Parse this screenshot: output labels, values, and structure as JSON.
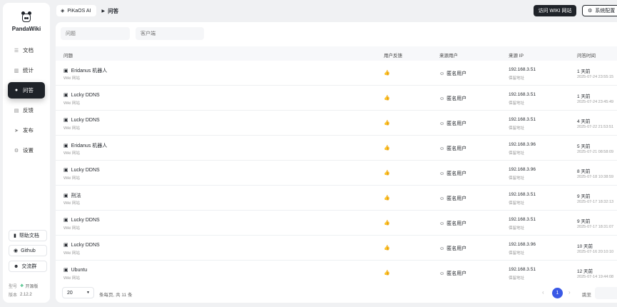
{
  "brand": {
    "name": "PandaWiki"
  },
  "sidebar": {
    "items": [
      {
        "icon": "document-icon",
        "label": "文档"
      },
      {
        "icon": "stats-icon",
        "label": "统计"
      },
      {
        "icon": "qa-icon",
        "label": "问答",
        "active": true
      },
      {
        "icon": "feedback-icon",
        "label": "反馈"
      },
      {
        "icon": "publish-icon",
        "label": "发布"
      },
      {
        "icon": "settings-icon",
        "label": "设置"
      }
    ],
    "footer": {
      "help": "帮助文档",
      "github": "Github",
      "community": "交流群",
      "edition_key": "型号",
      "edition_value": "开源版",
      "version_key": "版本",
      "version_value": "2.12.2"
    }
  },
  "header": {
    "workspace": "PiKaOS AI",
    "current": "问答",
    "visit_wiki": "访问 WIKI 网站",
    "system_config": "系统配置"
  },
  "filters": {
    "question_placeholder": "问题",
    "client_placeholder": "客户端"
  },
  "table": {
    "columns": [
      "问题",
      "用户反馈",
      "来源用户",
      "来源 IP",
      "问答时间"
    ],
    "rows": [
      {
        "question": "Eridanus 机器人",
        "source": "Wiki 网站",
        "user": "匿名用户",
        "ip": "192.168.3.51",
        "ip_location": "保留地址",
        "time": "1 天前",
        "datetime": "2025-07-24 23:55:15"
      },
      {
        "question": "Lucky DDNS",
        "source": "Wiki 网站",
        "user": "匿名用户",
        "ip": "192.168.3.51",
        "ip_location": "保留地址",
        "time": "1 天前",
        "datetime": "2025-07-24 23:45:49"
      },
      {
        "question": "Lucky DDNS",
        "source": "Wiki 网站",
        "user": "匿名用户",
        "ip": "192.168.3.51",
        "ip_location": "保留地址",
        "time": "4 天前",
        "datetime": "2025-07-22 21:53:51"
      },
      {
        "question": "Eridanus 机器人",
        "source": "Wiki 网站",
        "user": "匿名用户",
        "ip": "192.168.3.96",
        "ip_location": "保留地址",
        "time": "5 天前",
        "datetime": "2025-07-21 08:58:09"
      },
      {
        "question": "Lucky DDNS",
        "source": "Wiki 网站",
        "user": "匿名用户",
        "ip": "192.168.3.96",
        "ip_location": "保留地址",
        "time": "8 天前",
        "datetime": "2025-07-18 10:38:59"
      },
      {
        "question": "刑法",
        "source": "Wiki 网站",
        "user": "匿名用户",
        "ip": "192.168.3.51",
        "ip_location": "保留地址",
        "time": "9 天前",
        "datetime": "2025-07-17 18:32:13"
      },
      {
        "question": "Lucky DDNS",
        "source": "Wiki 网站",
        "user": "匿名用户",
        "ip": "192.168.3.51",
        "ip_location": "保留地址",
        "time": "9 天前",
        "datetime": "2025-07-17 18:31:07"
      },
      {
        "question": "Lucky DDNS",
        "source": "Wiki 网站",
        "user": "匿名用户",
        "ip": "192.168.3.96",
        "ip_location": "保留地址",
        "time": "10 天前",
        "datetime": "2025-07-16 20:10:10"
      },
      {
        "question": "Ubuntu",
        "source": "Wiki 网站",
        "user": "匿名用户",
        "ip": "192.168.3.51",
        "ip_location": "保留地址",
        "time": "12 天前",
        "datetime": "2025-07-14 19:44:08"
      }
    ]
  },
  "pagination": {
    "page_size": "20",
    "info": "条每页, 共 11 条",
    "current_page": "1",
    "goto_label": "跳至"
  }
}
